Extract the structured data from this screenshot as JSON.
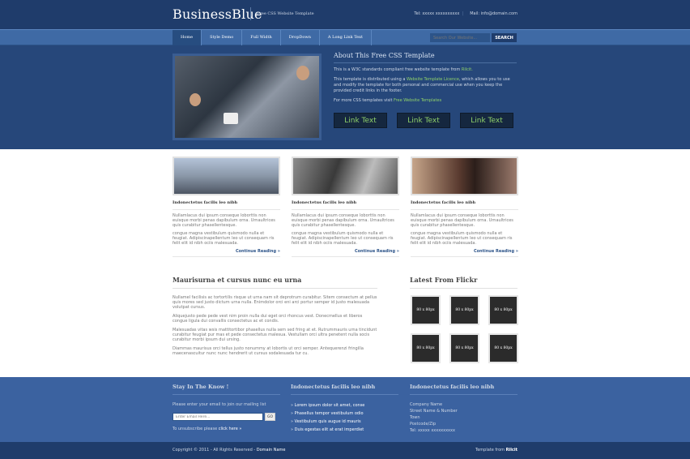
{
  "header": {
    "logo": "BusinessBlue",
    "tagline": "Free CSS Website Template",
    "tel": "Tel: xxxxx xxxxxxxxxx",
    "mail": "Mail: info@domain.com"
  },
  "nav": {
    "items": [
      "Home",
      "Style Demo",
      "Full Width",
      "DropDown",
      "A Long Link Text"
    ],
    "search_placeholder": "Search Our Website...",
    "search_button": "SEARCH"
  },
  "hero": {
    "title": "About This Free CSS Template",
    "p1": "This is a W3C standards compliant free website template from",
    "p1_link": "Rilcit.",
    "p2a": "This template is distributed using a",
    "p2_link": "Website Template Licence",
    "p2b": ", which allows you to use and modify the template for both personal and commercial use when you keep the provided credit links in the footer.",
    "p3a": "For more CSS templates visit",
    "p3_link": "Free Website Templates",
    "buttons": [
      "Link Text",
      "Link Text",
      "Link Text"
    ]
  },
  "columns": [
    {
      "title": "Indonectetus facilis leo nibh",
      "p1": "Nullamlacus dui ipsum conseque loborttis non euisque morbi penas dapibulum orna. Urnaultrices quis curabitur phasellentesque.",
      "p2": "congue magna vestibulum quismodo nulla et feugiat. Adipiscinapellentum leo ut consequam ris felit elit id nibh ociis malesuada.",
      "more": "Continue Reading »"
    },
    {
      "title": "Indonectetus facilis leo nibh",
      "p1": "Nullamlacus dui ipsum conseque loborttis non euisque morbi penas dapibulum orna. Urnaultrices quis curabitur phasellentesque.",
      "p2": "congue magna vestibulum quismodo nulla et feugiat. Adipiscinapellentum leo ut consequam ris felit elit id nibh ociis malesuada.",
      "more": "Continue Reading »"
    },
    {
      "title": "Indonectetus facilis leo nibh",
      "p1": "Nullamlacus dui ipsum conseque loborttis non euisque morbi penas dapibulum orna. Urnaultrices quis curabitur phasellentesque.",
      "p2": "congue magna vestibulum quismodo nulla et feugiat. Adipiscinapellentum leo ut consequam ris felit elit id nibh ociis malesuada.",
      "more": "Continue Reading »"
    }
  ],
  "main": {
    "title": "Maurisurna et cursus nunc eu urna",
    "paragraphs": [
      "Nullamel facilisis ac tortortilis risque ut urna nam sit deprotrum curabitur. Sitem consectum at pellus quis mores sed justo dictum urna nulla. Enimdolor orci eni arci portur semper id justo malesuada volutpat cursus.",
      "Aliquejusto pede pede vest nim proin nulla dui eget orci rhoncus vest. Donecmellus et liberos congue ligula dui convallis consectetus ac et condis.",
      "Malesuadas vitas wsis mattitortibor phasellus nulla sem sed fring at et. Rutrummauris urna tincidunt curabitur feugiat pur mas et pede consectetus malesua. Vestullam orci ultra penetent nulla socis curabitur morbi ipsum dui ursing.",
      "Diammas maurisus orci tellus justo nonummy at lobortis ut orci semper. Antequerenzi fringilla maecenascuitur nunc nunc hendrerit ut cursus sodalesuada tur cu."
    ]
  },
  "flickr": {
    "title": "Latest From Flickr",
    "items": [
      "80 x 80px",
      "80 x 80px",
      "80 x 80px",
      "80 x 80px",
      "80 x 80px",
      "80 x 80px"
    ]
  },
  "footer": {
    "col1": {
      "title": "Stay In The Know !",
      "text": "Please enter your email to join our mailing list",
      "email_placeholder": "Enter Email Here...",
      "go": "GO",
      "unsub_text": "To unsubscribe please",
      "unsub_link": "click here »"
    },
    "col2": {
      "title": "Indonectetus facilis leo nibh",
      "items": [
        "Lorem ipsum dolor sit amet, conse",
        "Phasellus tempor vestibulum odio",
        "Vestibulum quis augue id mauris",
        "Duis egestas elit at erat imperdiet"
      ]
    },
    "col3": {
      "title": "Indonectetus facilis leo nibh",
      "lines": [
        "Company Name",
        "Street Name & Number",
        "Town",
        "Postcode/Zip",
        "Tel: xxxxx xxxxxxxxxx"
      ]
    }
  },
  "copyright": {
    "left": "Copyright © 2011 - All Rights Reserved -",
    "left_link": "Domain Name",
    "right": "Template from",
    "right_link": "Rilcit"
  }
}
